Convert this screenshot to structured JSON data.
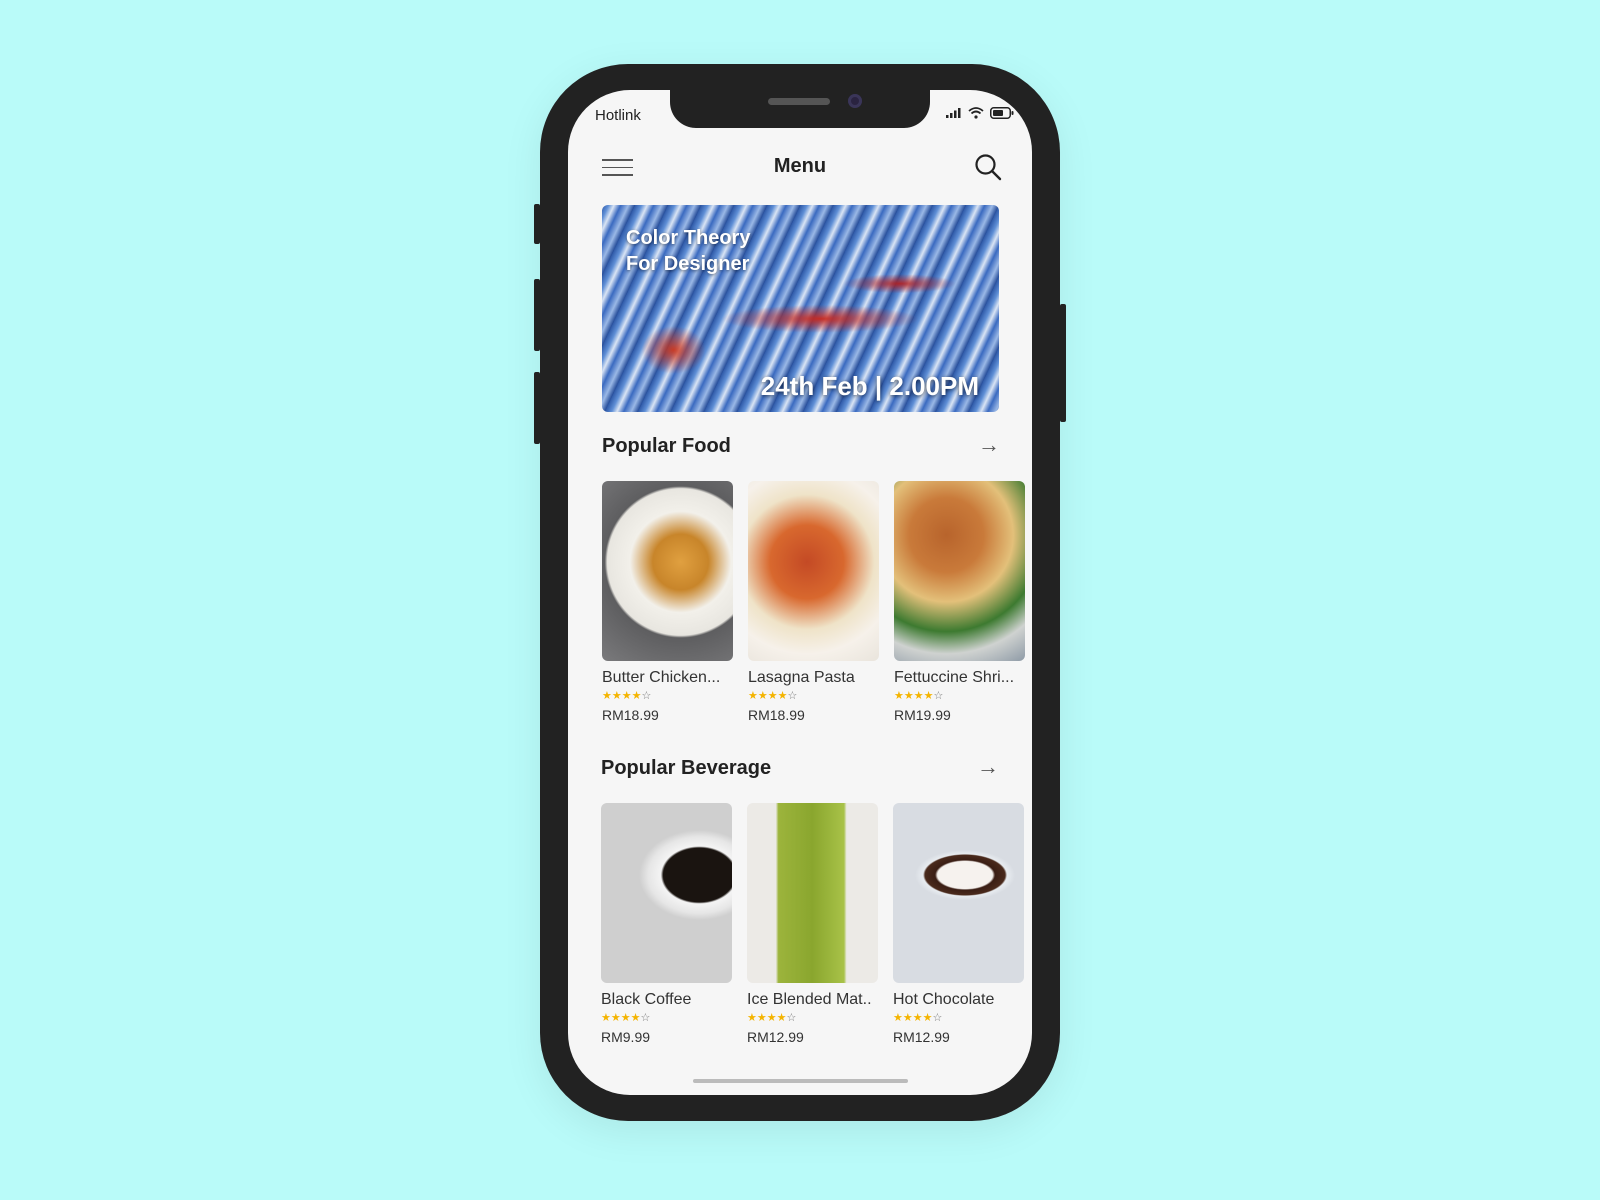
{
  "status_bar": {
    "carrier": "Hotlink"
  },
  "header": {
    "title": "Menu",
    "menu_icon": "hamburger-icon",
    "search_icon": "search-icon"
  },
  "banner": {
    "title_line1": "Color Theory",
    "title_line2": "For Designer",
    "date": "24th Feb | 2.00PM"
  },
  "sections": [
    {
      "title": "Popular Food",
      "items": [
        {
          "name": "Butter Chicken...",
          "rating": 4,
          "max_rating": 5,
          "price": "RM18.99"
        },
        {
          "name": "Lasagna Pasta",
          "rating": 4,
          "max_rating": 5,
          "price": "RM18.99"
        },
        {
          "name": "Fettuccine Shri...",
          "rating": 4,
          "max_rating": 5,
          "price": "RM19.99"
        }
      ]
    },
    {
      "title": "Popular Beverage",
      "items": [
        {
          "name": "Black Coffee",
          "rating": 4,
          "max_rating": 5,
          "price": "RM9.99"
        },
        {
          "name": "Ice Blended Mat..",
          "rating": 4,
          "max_rating": 5,
          "price": "RM12.99"
        },
        {
          "name": "Hot Chocolate",
          "rating": 4,
          "max_rating": 5,
          "price": "RM12.99"
        }
      ]
    }
  ],
  "colors": {
    "background": "#b9fbf9",
    "star": "#f4b400",
    "screen": "#f6f6f6"
  }
}
